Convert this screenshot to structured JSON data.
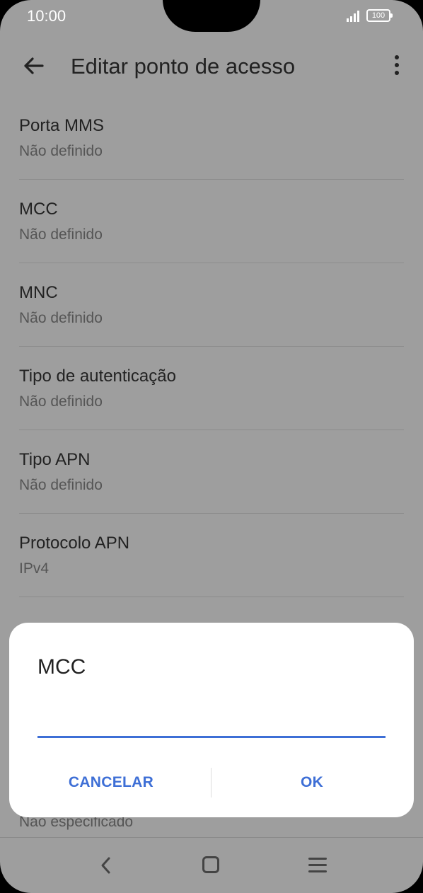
{
  "status_bar": {
    "time": "10:00",
    "battery": "100"
  },
  "app_bar": {
    "title": "Editar ponto de acesso",
    "back_icon": "arrow-left-icon",
    "more_icon": "more-vert-icon"
  },
  "settings": [
    {
      "title": "Porta MMS",
      "subtitle": "Não definido"
    },
    {
      "title": "MCC",
      "subtitle": "Não definido"
    },
    {
      "title": "MNC",
      "subtitle": "Não definido"
    },
    {
      "title": "Tipo de autenticação",
      "subtitle": "Não definido"
    },
    {
      "title": "Tipo APN",
      "subtitle": "Não definido"
    },
    {
      "title": "Protocolo APN",
      "subtitle": "IPv4"
    }
  ],
  "obscured_item": {
    "subtitle": "Não especificado"
  },
  "dialog": {
    "title": "MCC",
    "input_value": "",
    "cancel_label": "CANCELAR",
    "ok_label": "OK",
    "accent_color": "#3e6fd6"
  },
  "nav_bar": {
    "icons": [
      "back-icon",
      "home-icon",
      "menu-icon"
    ]
  }
}
